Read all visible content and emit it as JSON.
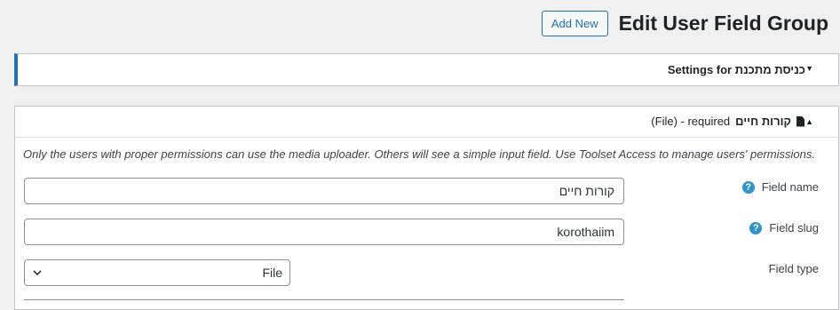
{
  "header": {
    "title": "Edit User Field Group",
    "add_new_label": "Add New"
  },
  "settings_panel": {
    "title": "Settings for כניסת מתכנת"
  },
  "field_panel": {
    "field_display_name": "קורות חיים",
    "field_meta": "(File) - required",
    "notice": "Only the users with proper permissions can use the media uploader. Others will see a simple input field. Use Toolset Access to manage users' permissions.",
    "rows": {
      "name_label": "Field name",
      "name_value": "קורות חיים",
      "slug_label": "Field slug",
      "slug_value": "korothaiim",
      "type_label": "Field type",
      "type_value": "File"
    }
  },
  "icons": {
    "help": "help-icon",
    "document": "document-icon",
    "toggle_down": "caret-down-icon",
    "toggle_up": "caret-up-icon",
    "select_chevron": "chevron-down-icon"
  },
  "colors": {
    "accent": "#2271b1",
    "help": "#2f94c8",
    "background": "#f0f0f1"
  }
}
